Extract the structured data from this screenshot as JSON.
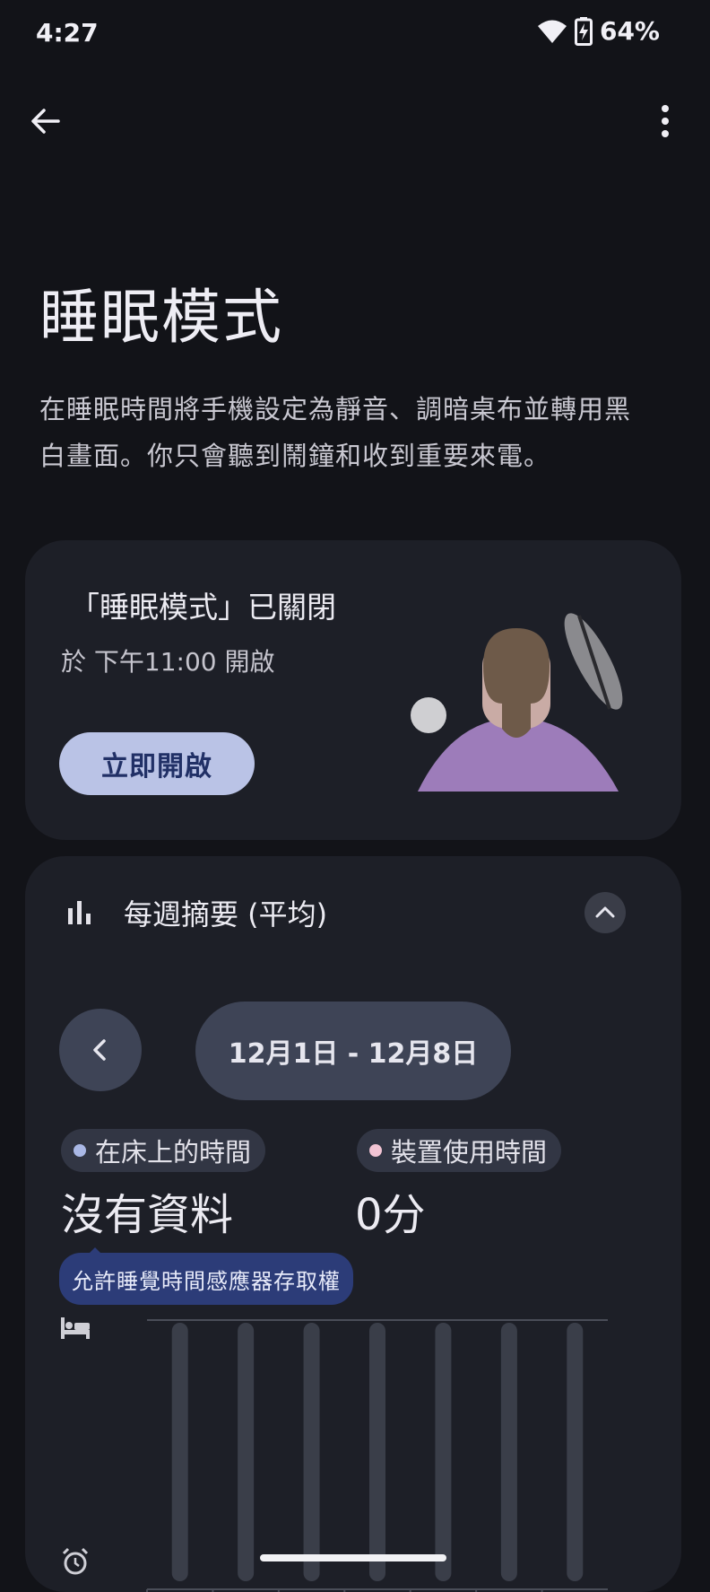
{
  "status_bar": {
    "time": "4:27",
    "battery": "64%",
    "wifi_icon": "wifi-icon",
    "battery_icon": "battery-charging-icon"
  },
  "app_bar": {
    "back_icon": "back-arrow-icon",
    "more_icon": "more-vert-icon"
  },
  "page": {
    "title": "睡眠模式",
    "description_line1": "在睡眠時間將手機設定為靜音、調暗桌布並轉用黑",
    "description_line2": "白畫面。你只會聽到鬧鐘和收到重要來電。"
  },
  "status_card": {
    "title": "「睡眠模式」已關閉",
    "schedule": "於 下午11:00 開啟",
    "button": "立即開啟"
  },
  "weekly_card": {
    "title": "每週摘要 (平均)",
    "date_range": "12月1日 - 12月8日",
    "legend": [
      {
        "label": "在床上的時間",
        "color": "#aab8e6"
      },
      {
        "label": "裝置使用時間",
        "color": "#f2c4d4"
      }
    ],
    "bed_value": "沒有資料",
    "device_value": "0分",
    "permission_tooltip": "允許睡覺時間感應器存取權"
  },
  "chart_data": {
    "type": "bar",
    "days": 7,
    "series": [
      {
        "values": [
          0,
          0,
          0,
          0,
          0,
          0,
          0
        ]
      },
      {
        "values": [
          0,
          0,
          0,
          0,
          0,
          0,
          0
        ]
      }
    ],
    "grid": true,
    "track_color": "#3a3e49"
  },
  "colors": {
    "background": "#121318",
    "card": "#1d1f27",
    "accent_button": "#bac3e6",
    "tooltip": "#2c3c78"
  }
}
